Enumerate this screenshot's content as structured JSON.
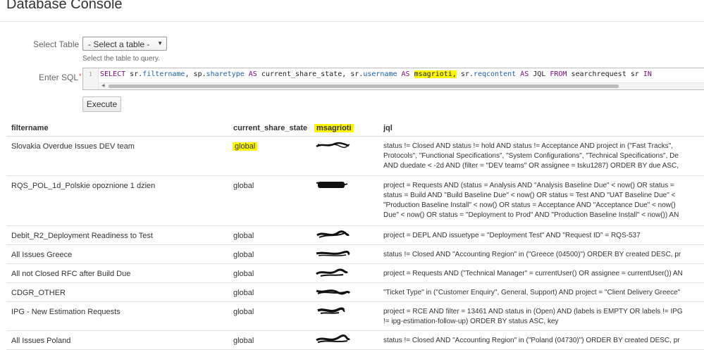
{
  "page": {
    "title": "Database Console"
  },
  "form": {
    "table_label": "Select Table",
    "table_select_value": "- Select a table -",
    "table_hint": "Select the table to query.",
    "sql_label": "Enter SQL",
    "required_mark": "*",
    "line_number": "1",
    "sql_tokens": {
      "t1": "SELECT",
      "t2": " sr.",
      "t3": "filtername",
      "t4": ", sp.",
      "t5": "sharetype",
      "t6": " ",
      "t7": "AS",
      "t8": " current_share_state, sr.",
      "t9": "username",
      "t10": " ",
      "t11": "AS",
      "t12": " ",
      "t13": "msagrioti,",
      "t14": " sr.",
      "t15": "reqcontent",
      "t16": " ",
      "t17": "AS",
      "t18": " JQL ",
      "t19": "FROM",
      "t20": " searchrequest sr ",
      "t21": "IN"
    },
    "execute_label": "Execute"
  },
  "results": {
    "columns": [
      "filtername",
      "current_share_state",
      "msagrioti",
      "jql"
    ],
    "rows": [
      {
        "filtername": "Slovakia Overdue Issues DEV team",
        "state": "global",
        "jql": "status != Closed AND status != hold AND status != Acceptance AND project in (\"Fast Tracks\",\nProtocols\", \"Functional Specifications\", \"System Configurations\", \"Technical Specifications\", De\nAND duedate < -2d AND (filter = \"DEV teams\" OR assignee = tsku1287) ORDER BY due ASC,"
      },
      {
        "filtername": "RQS_POL_1d_Polskie opoznione 1 dzien",
        "state": "global",
        "jql": "project = Requests AND (status = Analysis AND \"Analysis Baseline Due\" < now() OR status =\nstatus = Build AND \"Build Baseline Due\" < now() OR status = Test AND \"UAT Baseline Due\" <\n\"Production Baseline Install\" < now() OR status = Acceptance AND \"Acceptance Due\" < now()\nDue\" < now() OR status = \"Deployment to Prod\" AND \"Production Baseline Install\" < now()) AN"
      },
      {
        "filtername": "Debit_R2_Deployment Readiness to Test",
        "state": "global",
        "jql": "project = DEPL AND issuetype = \"Deployment Test\" AND \"Request ID\" = RQS-537"
      },
      {
        "filtername": "All Issues Greece",
        "state": "global",
        "jql": "status != Closed AND \"Accounting Region\" in (\"Greece (04500)\") ORDER BY created DESC, pr"
      },
      {
        "filtername": "All not Closed RFC after Build Due",
        "state": "global",
        "jql": "project = Requests AND (\"Technical Manager\" = currentUser() OR assignee = currentUser()) AN"
      },
      {
        "filtername": "CDGR_OTHER",
        "state": "global",
        "jql": "\"Ticket Type\" in (\"Customer Enquiry\", General, Support) AND project = \"Client Delivery Greece\""
      },
      {
        "filtername": "IPG - New Estimation Requests",
        "state": "global",
        "jql": "project = RCE AND filter = 13461 AND status in (Open) AND (labels is EMPTY OR labels != IPG\n!= ipg-estimation-follow-up) ORDER BY status ASC, key"
      },
      {
        "filtername": "All Issues Poland",
        "state": "global",
        "jql": "status != Closed AND \"Accounting Region\" in (\"Poland (04730)\") ORDER BY created DESC, pr"
      }
    ]
  },
  "colors": {
    "highlight": "#fff700",
    "keyword": "#7a0b7a",
    "field": "#1862a7",
    "redaction": "#111111"
  }
}
